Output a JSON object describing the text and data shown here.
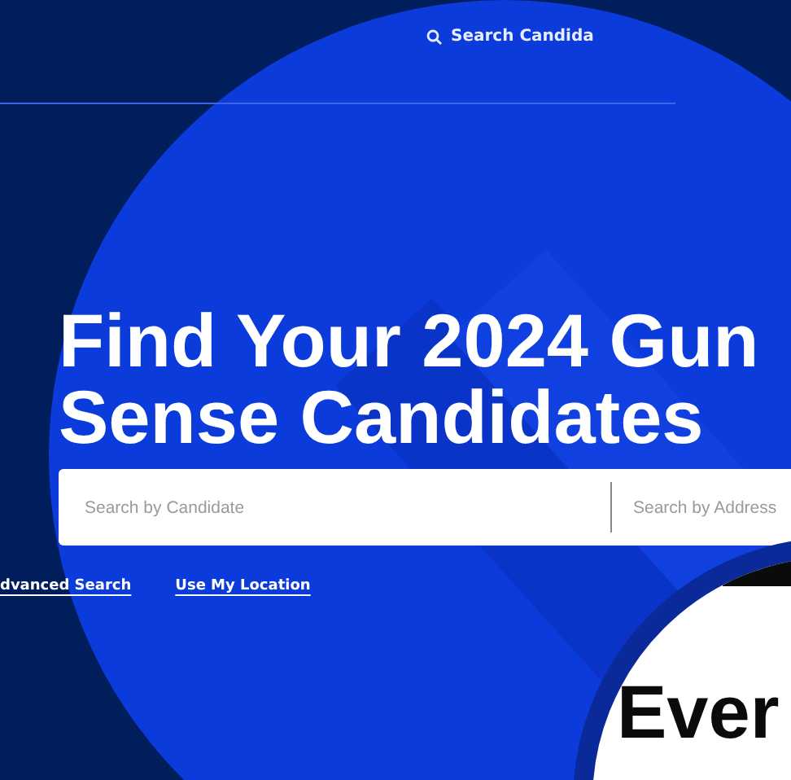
{
  "nav": {
    "search_link": "Search Candida"
  },
  "hero": {
    "title_lines": [
      "Find Your 2024 Gun",
      "Sense Candidates"
    ]
  },
  "search": {
    "fields": [
      {
        "placeholder": "Search by Candidate"
      },
      {
        "placeholder": "Search by Address"
      }
    ]
  },
  "links": [
    "dvanced Search",
    "Use My Location"
  ],
  "next_section": {
    "heading": "Ever"
  }
}
